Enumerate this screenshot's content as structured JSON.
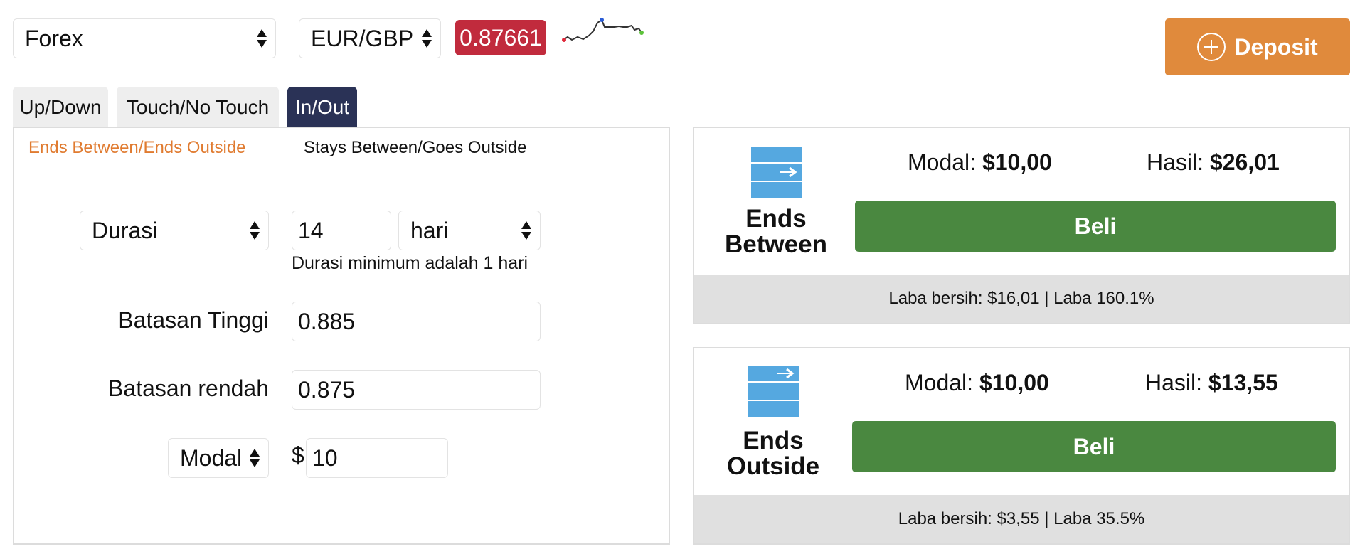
{
  "market_select": {
    "value": "Forex"
  },
  "asset_select": {
    "value": "EUR/GBP"
  },
  "price": {
    "value": "0.87661",
    "color": "#c12b3d"
  },
  "deposit": {
    "label": "Deposit",
    "color": "#e08a3c"
  },
  "tabs": [
    {
      "label": "Up/Down",
      "active": false
    },
    {
      "label": "Touch/No Touch",
      "active": false
    },
    {
      "label": "In/Out",
      "active": true
    }
  ],
  "subtabs": [
    {
      "label": "Ends Between/Ends Outside",
      "active": true
    },
    {
      "label": "Stays Between/Goes Outside",
      "active": false
    }
  ],
  "form": {
    "duration_select": "Durasi",
    "duration_value": "14",
    "duration_unit": "hari",
    "duration_hint": "Durasi minimum adalah 1 hari",
    "high_barrier_label": "Batasan Tinggi",
    "high_barrier_value": "0.885",
    "low_barrier_label": "Batasan rendah",
    "low_barrier_value": "0.875",
    "stake_select": "Modal",
    "currency_symbol": "$",
    "stake_value": "10"
  },
  "contracts": [
    {
      "title_line1": "Ends",
      "title_line2": "Between",
      "stake_label": "Modal:",
      "stake_value": "$10,00",
      "payout_label": "Hasil:",
      "payout_value": "$26,01",
      "buy_label": "Beli",
      "footer": "Laba bersih: $16,01 | Laba 160.1%"
    },
    {
      "title_line1": "Ends",
      "title_line2": "Outside",
      "stake_label": "Modal:",
      "stake_value": "$10,00",
      "payout_label": "Hasil:",
      "payout_value": "$13,55",
      "buy_label": "Beli",
      "footer": "Laba bersih: $3,55 | Laba 35.5%"
    }
  ],
  "colors": {
    "accent": "#e07b30",
    "tab_active": "#2a3256",
    "buy": "#4a8840",
    "icon": "#55a8e0"
  }
}
